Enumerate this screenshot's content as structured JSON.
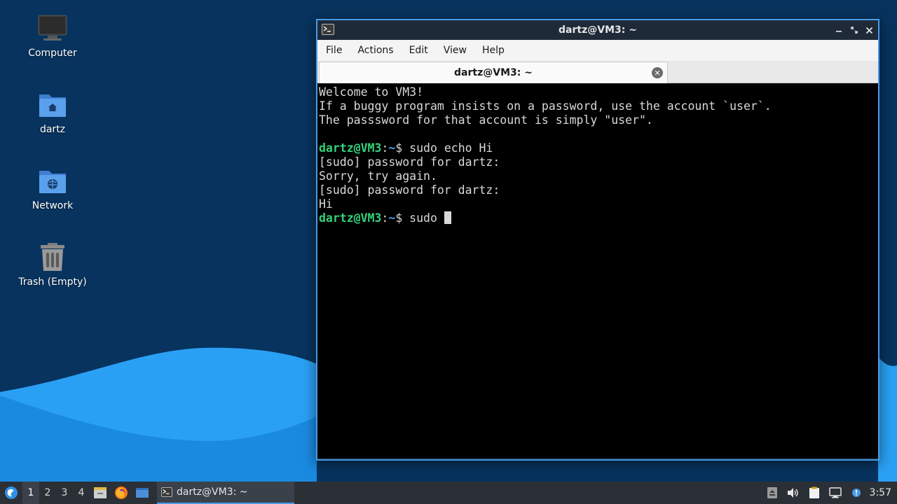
{
  "desktop": {
    "icons": [
      {
        "label": "Computer",
        "icon": "computer-icon"
      },
      {
        "label": "dartz",
        "icon": "home-folder-icon"
      },
      {
        "label": "Network",
        "icon": "network-folder-icon"
      },
      {
        "label": "Trash (Empty)",
        "icon": "trash-icon"
      }
    ]
  },
  "window": {
    "title": "dartz@VM3: ~",
    "menu": [
      "File",
      "Actions",
      "Edit",
      "View",
      "Help"
    ],
    "tab": {
      "label": "dartz@VM3: ~"
    },
    "terminal": {
      "lines": [
        "Welcome to VM3!",
        "If a buggy program insists on a password, use the account `user`.",
        "The passsword for that account is simply \"user\".",
        "",
        "[sudo] password for dartz:",
        "Sorry, try again.",
        "[sudo] password for dartz:",
        "Hi"
      ],
      "prompt_user": "dartz@VM3",
      "prompt_sep": ":",
      "prompt_path": "~",
      "prompt_dollar": "$ ",
      "cmd1": "sudo echo Hi",
      "cmd2": "sudo "
    }
  },
  "taskbar": {
    "workspaces": [
      "1",
      "2",
      "3",
      "4"
    ],
    "active_workspace": "1",
    "launchers": [
      "file-manager-icon",
      "firefox-icon",
      "show-desktop-icon"
    ],
    "task_label": "dartz@VM3: ~",
    "tray": [
      "update-icon",
      "volume-icon",
      "clipboard-icon",
      "network-icon",
      "notification-icon"
    ],
    "clock": "3:57"
  },
  "colors": {
    "accent": "#4a9be6",
    "prompt_user": "#33d17a",
    "prompt_path": "#4ea0f0",
    "wallpaper_dark": "#07335e",
    "wallpaper_wave": "#1a93ef"
  }
}
